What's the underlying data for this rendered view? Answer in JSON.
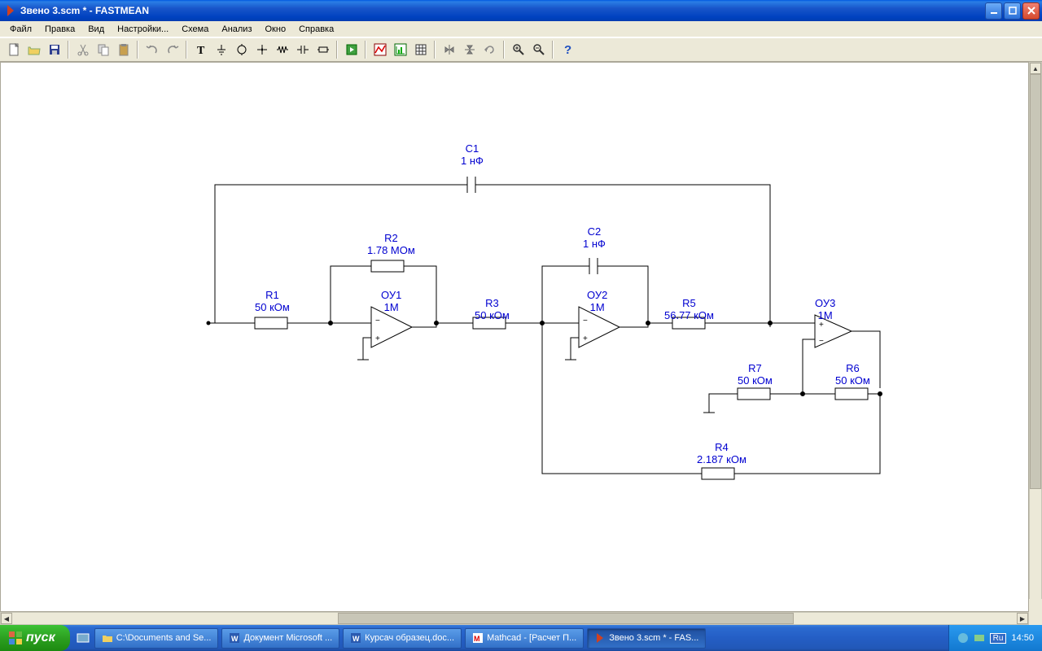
{
  "window": {
    "title": "Звено 3.scm * - FASTMEAN"
  },
  "menu": {
    "file": "Файл",
    "edit": "Правка",
    "view": "Вид",
    "settings": "Настройки...",
    "scheme": "Схема",
    "analysis": "Анализ",
    "window": "Окно",
    "help": "Справка"
  },
  "components": {
    "c1": {
      "name": "C1",
      "value": "1 нФ"
    },
    "c2": {
      "name": "C2",
      "value": "1 нФ"
    },
    "r1": {
      "name": "R1",
      "value": "50 кОм"
    },
    "r2": {
      "name": "R2",
      "value": "1.78 МОм"
    },
    "r3": {
      "name": "R3",
      "value": "50 кОм"
    },
    "r4": {
      "name": "R4",
      "value": "2.187 кОм"
    },
    "r5": {
      "name": "R5",
      "value": "56.77 кОм"
    },
    "r6": {
      "name": "R6",
      "value": "50 кОм"
    },
    "r7": {
      "name": "R7",
      "value": "50 кОм"
    },
    "ou1": {
      "name": "ОУ1",
      "value": "1М"
    },
    "ou2": {
      "name": "ОУ2",
      "value": "1М"
    },
    "ou3": {
      "name": "ОУ3",
      "value": "1М"
    }
  },
  "taskbar": {
    "start": "пуск",
    "items": [
      "C:\\Documents and Se...",
      "Документ Microsoft ...",
      "Курсач образец.doc...",
      "Mathcad - [Расчет П...",
      "Звено 3.scm * - FAS..."
    ],
    "lang": "Ru",
    "clock": "14:50"
  }
}
